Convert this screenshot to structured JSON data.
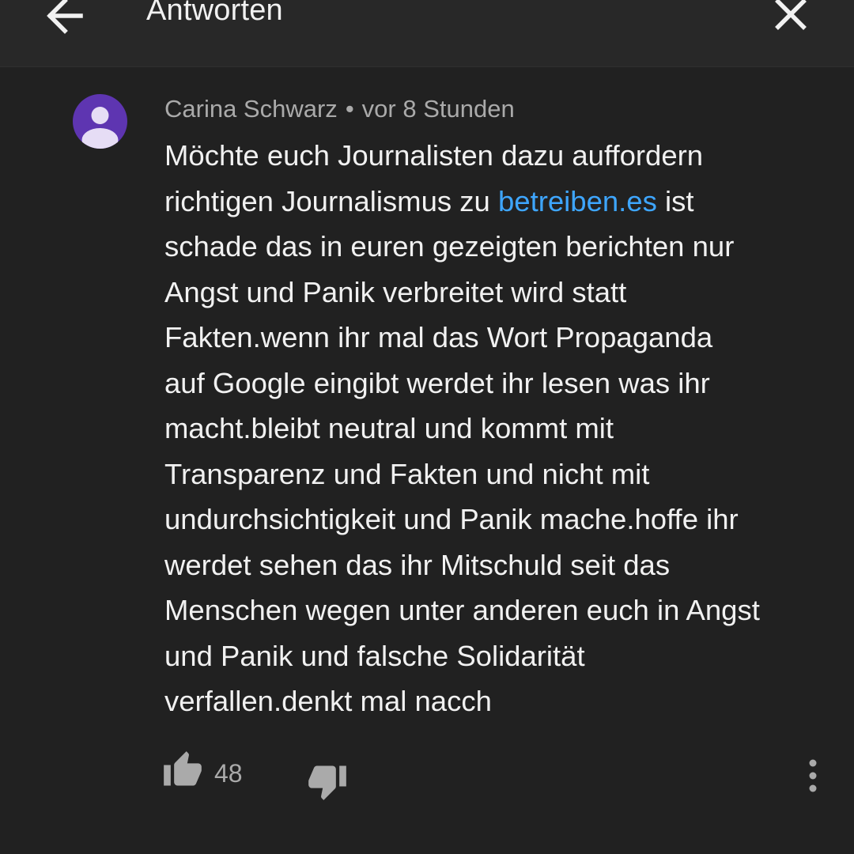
{
  "header": {
    "title": "Antworten",
    "back_icon": "arrow-left-icon",
    "close_icon": "close-icon"
  },
  "comment": {
    "author": "Carina Schwarz",
    "separator": "•",
    "time": "vor 8 Stunden",
    "avatar_icon": "default-avatar-icon",
    "avatar_color": "#5e35b1",
    "lines": [
      "Möchte euch Journalisten dazu auffordern",
      "richtigen Journalismus zu ",
      "schade das in euren gezeigten berichten nur",
      "Angst und Panik verbreitet wird statt",
      "Fakten.wenn ihr mal das Wort Propaganda",
      "auf Google eingibt werdet ihr lesen was ihr",
      "macht.bleibt neutral und kommt mit",
      "Transparenz und Fakten und nicht mit",
      "undurchsichtigkeit und Panik mache.hoffe ihr",
      "werdet sehen das ihr Mitschuld seit das",
      "Menschen wegen unter anderen euch in Angst",
      "und Panik und falsche Solidarität",
      "verfallen.denkt mal nacch"
    ],
    "link_text": "betreiben.es",
    "link_suffix": " ist",
    "link_color": "#3ea6ff"
  },
  "actions": {
    "like_icon": "thumbs-up-icon",
    "like_count": "48",
    "dislike_icon": "thumbs-down-icon",
    "more_icon": "more-vertical-icon"
  }
}
